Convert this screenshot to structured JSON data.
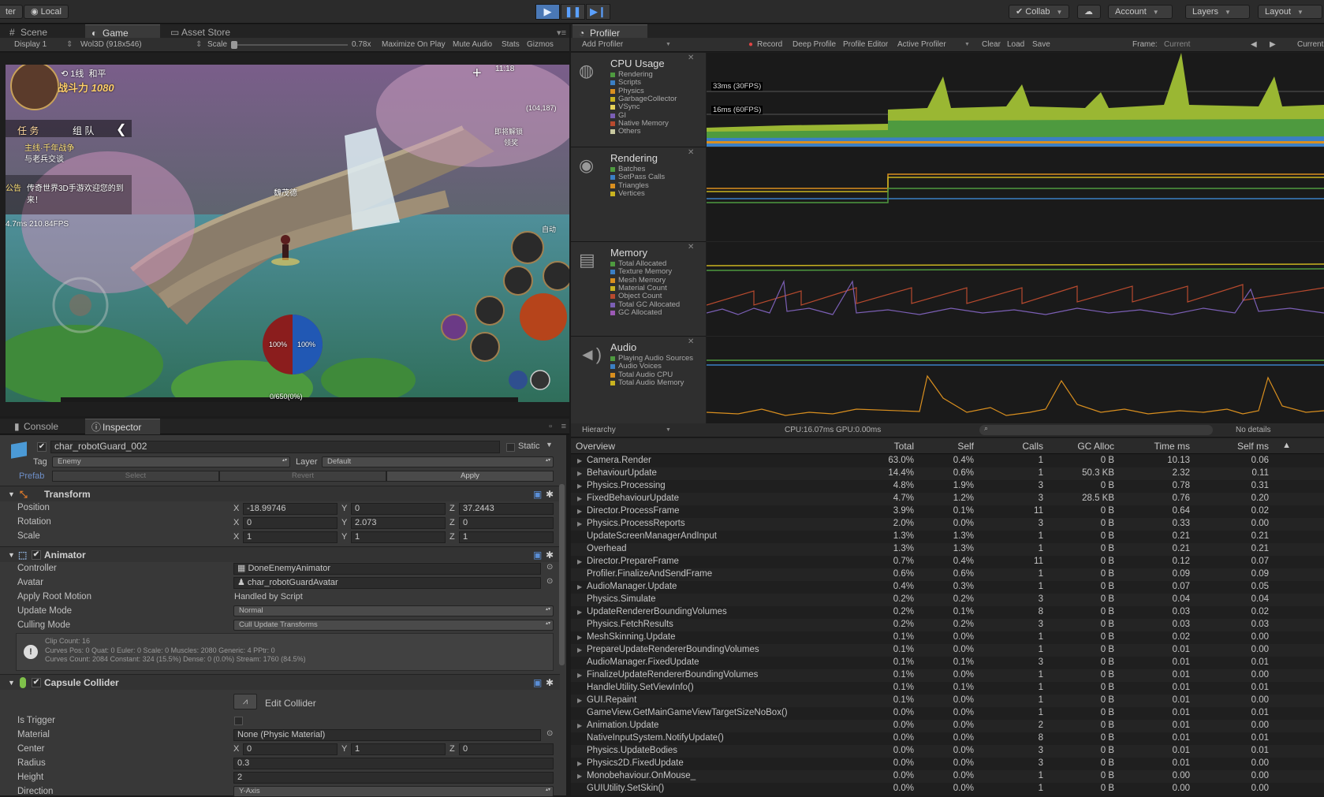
{
  "toolbar": {
    "left_fragment": "ter",
    "local_label": "Local",
    "collab_label": "Collab",
    "account_label": "Account",
    "layers_label": "Layers",
    "layout_label": "Layout"
  },
  "left_tabs": {
    "scene": "Scene",
    "game": "Game",
    "asset_store": "Asset Store"
  },
  "game_toolbar": {
    "display": "Display 1",
    "resolution": "Wol3D (918x546)",
    "scale_label": "Scale",
    "scale_value": "0.78x",
    "maximize_on_play": "Maximize On Play",
    "mute_audio": "Mute Audio",
    "stats": "Stats",
    "gizmos": "Gizmos"
  },
  "game": {
    "level": "1线",
    "peace": "和平",
    "power_label": "战斗力",
    "power": "1080",
    "time": "11:18",
    "tab_task": "任 务",
    "tab_team": "组 队",
    "quest_main": "主线·千年战争",
    "quest_talk": "与老兵交谈",
    "announce_tag": "公告",
    "announce_text": "传奇世界3D手游欢迎您的到来！",
    "fps": "4.7ms 210.84FPS",
    "npc_name": "魏茂德",
    "unlock_label": "即将解锁",
    "unlock_sub": "领奖",
    "map_coords": "(104,187)",
    "hp": "100%",
    "mp": "100%",
    "exp": "0/650(0%)",
    "auto_label": "自动"
  },
  "bottom_tabs": {
    "console": "Console",
    "inspector": "Inspector"
  },
  "inspector": {
    "object_name": "char_robotGuard_002",
    "static_label": "Static",
    "tag_label": "Tag",
    "tag_value": "Enemy",
    "layer_label": "Layer",
    "layer_value": "Default",
    "prefab_label": "Prefab",
    "select_label": "Select",
    "revert_label": "Revert",
    "apply_label": "Apply",
    "transform": {
      "title": "Transform",
      "position_label": "Position",
      "pos_x": "-18.99746",
      "pos_y": "0",
      "pos_z": "37.2443",
      "rotation_label": "Rotation",
      "rot_x": "0",
      "rot_y": "2.073",
      "rot_z": "0",
      "scale_label": "Scale",
      "scale_x": "1",
      "scale_y": "1",
      "scale_z": "1"
    },
    "animator": {
      "title": "Animator",
      "controller_label": "Controller",
      "controller_value": "DoneEnemyAnimator",
      "avatar_label": "Avatar",
      "avatar_value": "char_robotGuardAvatar",
      "root_motion_label": "Apply Root Motion",
      "root_motion_value": "Handled by Script",
      "update_mode_label": "Update Mode",
      "update_mode_value": "Normal",
      "culling_label": "Culling Mode",
      "culling_value": "Cull Update Transforms",
      "info_1": "Clip Count: 16",
      "info_2": "Curves Pos: 0 Quat: 0 Euler: 0 Scale: 0 Muscles: 2080 Generic: 4 PPtr: 0",
      "info_3": "Curves Count: 2084 Constant: 324 (15.5%) Dense: 0 (0.0%) Stream: 1760 (84.5%)"
    },
    "collider": {
      "title": "Capsule Collider",
      "edit_label": "Edit Collider",
      "trigger_label": "Is Trigger",
      "material_label": "Material",
      "material_value": "None (Physic Material)",
      "center_label": "Center",
      "center_x": "0",
      "center_y": "1",
      "center_z": "0",
      "radius_label": "Radius",
      "radius_value": "0.3",
      "height_label": "Height",
      "height_value": "2",
      "direction_label": "Direction",
      "direction_value": "Y-Axis"
    },
    "axis_x": "X",
    "axis_y": "Y",
    "axis_z": "Z"
  },
  "profiler": {
    "tab": "Profiler",
    "add_profiler": "Add Profiler",
    "record": "Record",
    "deep_profile": "Deep Profile",
    "profile_editor": "Profile Editor",
    "active_profiler": "Active Profiler",
    "clear": "Clear",
    "load": "Load",
    "save": "Save",
    "frame_label": "Frame:",
    "frame_value": "Current",
    "current_btn": "Current",
    "fps30": "33ms (30FPS)",
    "fps60": "16ms (60FPS)",
    "modules": [
      {
        "title": "CPU Usage",
        "items": [
          "Rendering",
          "Scripts",
          "Physics",
          "GarbageCollector",
          "VSync",
          "GI",
          "Native Memory",
          "Others"
        ],
        "colors": [
          "#4e9a3f",
          "#3b7fc4",
          "#d98f1f",
          "#c9b320",
          "#e6d35a",
          "#7b5fb5",
          "#b84a2e",
          "#c9c9a0"
        ]
      },
      {
        "title": "Rendering",
        "items": [
          "Batches",
          "SetPass Calls",
          "Triangles",
          "Vertices"
        ],
        "colors": [
          "#4e9a3f",
          "#3b7fc4",
          "#d98f1f",
          "#c9b320"
        ]
      },
      {
        "title": "Memory",
        "items": [
          "Total Allocated",
          "Texture Memory",
          "Mesh Memory",
          "Material Count",
          "Object Count",
          "Total GC Allocated",
          "GC Allocated"
        ],
        "colors": [
          "#4e9a3f",
          "#3b7fc4",
          "#d98f1f",
          "#c9b320",
          "#b84a2e",
          "#7b5fb5",
          "#9c5ab5"
        ]
      },
      {
        "title": "Audio",
        "items": [
          "Playing Audio Sources",
          "Audio Voices",
          "Total Audio CPU",
          "Total Audio Memory"
        ],
        "colors": [
          "#4e9a3f",
          "#3b7fc4",
          "#d98f1f",
          "#c9b320"
        ]
      }
    ],
    "hierarchy_label": "Hierarchy",
    "cpu_gpu": "CPU:16.07ms   GPU:0.00ms",
    "no_details": "No details",
    "columns": [
      "Overview",
      "Total",
      "Self",
      "Calls",
      "GC Alloc",
      "Time ms",
      "Self ms"
    ],
    "rows": [
      [
        "Camera.Render",
        "63.0%",
        "0.4%",
        "1",
        "0 B",
        "10.13",
        "0.06",
        true
      ],
      [
        "BehaviourUpdate",
        "14.4%",
        "0.6%",
        "1",
        "50.3 KB",
        "2.32",
        "0.11",
        true
      ],
      [
        "Physics.Processing",
        "4.8%",
        "1.9%",
        "3",
        "0 B",
        "0.78",
        "0.31",
        true
      ],
      [
        "FixedBehaviourUpdate",
        "4.7%",
        "1.2%",
        "3",
        "28.5 KB",
        "0.76",
        "0.20",
        true
      ],
      [
        "Director.ProcessFrame",
        "3.9%",
        "0.1%",
        "11",
        "0 B",
        "0.64",
        "0.02",
        true
      ],
      [
        "Physics.ProcessReports",
        "2.0%",
        "0.0%",
        "3",
        "0 B",
        "0.33",
        "0.00",
        true
      ],
      [
        "UpdateScreenManagerAndInput",
        "1.3%",
        "1.3%",
        "1",
        "0 B",
        "0.21",
        "0.21",
        false
      ],
      [
        "Overhead",
        "1.3%",
        "1.3%",
        "1",
        "0 B",
        "0.21",
        "0.21",
        false
      ],
      [
        "Director.PrepareFrame",
        "0.7%",
        "0.4%",
        "11",
        "0 B",
        "0.12",
        "0.07",
        true
      ],
      [
        "Profiler.FinalizeAndSendFrame",
        "0.6%",
        "0.6%",
        "1",
        "0 B",
        "0.09",
        "0.09",
        false
      ],
      [
        "AudioManager.Update",
        "0.4%",
        "0.3%",
        "1",
        "0 B",
        "0.07",
        "0.05",
        true
      ],
      [
        "Physics.Simulate",
        "0.2%",
        "0.2%",
        "3",
        "0 B",
        "0.04",
        "0.04",
        false
      ],
      [
        "UpdateRendererBoundingVolumes",
        "0.2%",
        "0.1%",
        "8",
        "0 B",
        "0.03",
        "0.02",
        true
      ],
      [
        "Physics.FetchResults",
        "0.2%",
        "0.2%",
        "3",
        "0 B",
        "0.03",
        "0.03",
        false
      ],
      [
        "MeshSkinning.Update",
        "0.1%",
        "0.0%",
        "1",
        "0 B",
        "0.02",
        "0.00",
        true
      ],
      [
        "PrepareUpdateRendererBoundingVolumes",
        "0.1%",
        "0.0%",
        "1",
        "0 B",
        "0.01",
        "0.00",
        true
      ],
      [
        "AudioManager.FixedUpdate",
        "0.1%",
        "0.1%",
        "3",
        "0 B",
        "0.01",
        "0.01",
        false
      ],
      [
        "FinalizeUpdateRendererBoundingVolumes",
        "0.1%",
        "0.0%",
        "1",
        "0 B",
        "0.01",
        "0.00",
        true
      ],
      [
        "HandleUtility.SetViewInfo()",
        "0.1%",
        "0.1%",
        "1",
        "0 B",
        "0.01",
        "0.01",
        false
      ],
      [
        "GUI.Repaint",
        "0.1%",
        "0.0%",
        "1",
        "0 B",
        "0.01",
        "0.00",
        true
      ],
      [
        "GameView.GetMainGameViewTargetSizeNoBox()",
        "0.0%",
        "0.0%",
        "1",
        "0 B",
        "0.01",
        "0.01",
        false
      ],
      [
        "Animation.Update",
        "0.0%",
        "0.0%",
        "2",
        "0 B",
        "0.01",
        "0.00",
        true
      ],
      [
        "NativeInputSystem.NotifyUpdate()",
        "0.0%",
        "0.0%",
        "8",
        "0 B",
        "0.01",
        "0.01",
        false
      ],
      [
        "Physics.UpdateBodies",
        "0.0%",
        "0.0%",
        "3",
        "0 B",
        "0.01",
        "0.01",
        false
      ],
      [
        "Physics2D.FixedUpdate",
        "0.0%",
        "0.0%",
        "3",
        "0 B",
        "0.01",
        "0.00",
        true
      ],
      [
        "Monobehaviour.OnMouse_",
        "0.0%",
        "0.0%",
        "1",
        "0 B",
        "0.00",
        "0.00",
        true
      ],
      [
        "GUIUtility.SetSkin()",
        "0.0%",
        "0.0%",
        "1",
        "0 B",
        "0.00",
        "0.00",
        false
      ]
    ]
  }
}
